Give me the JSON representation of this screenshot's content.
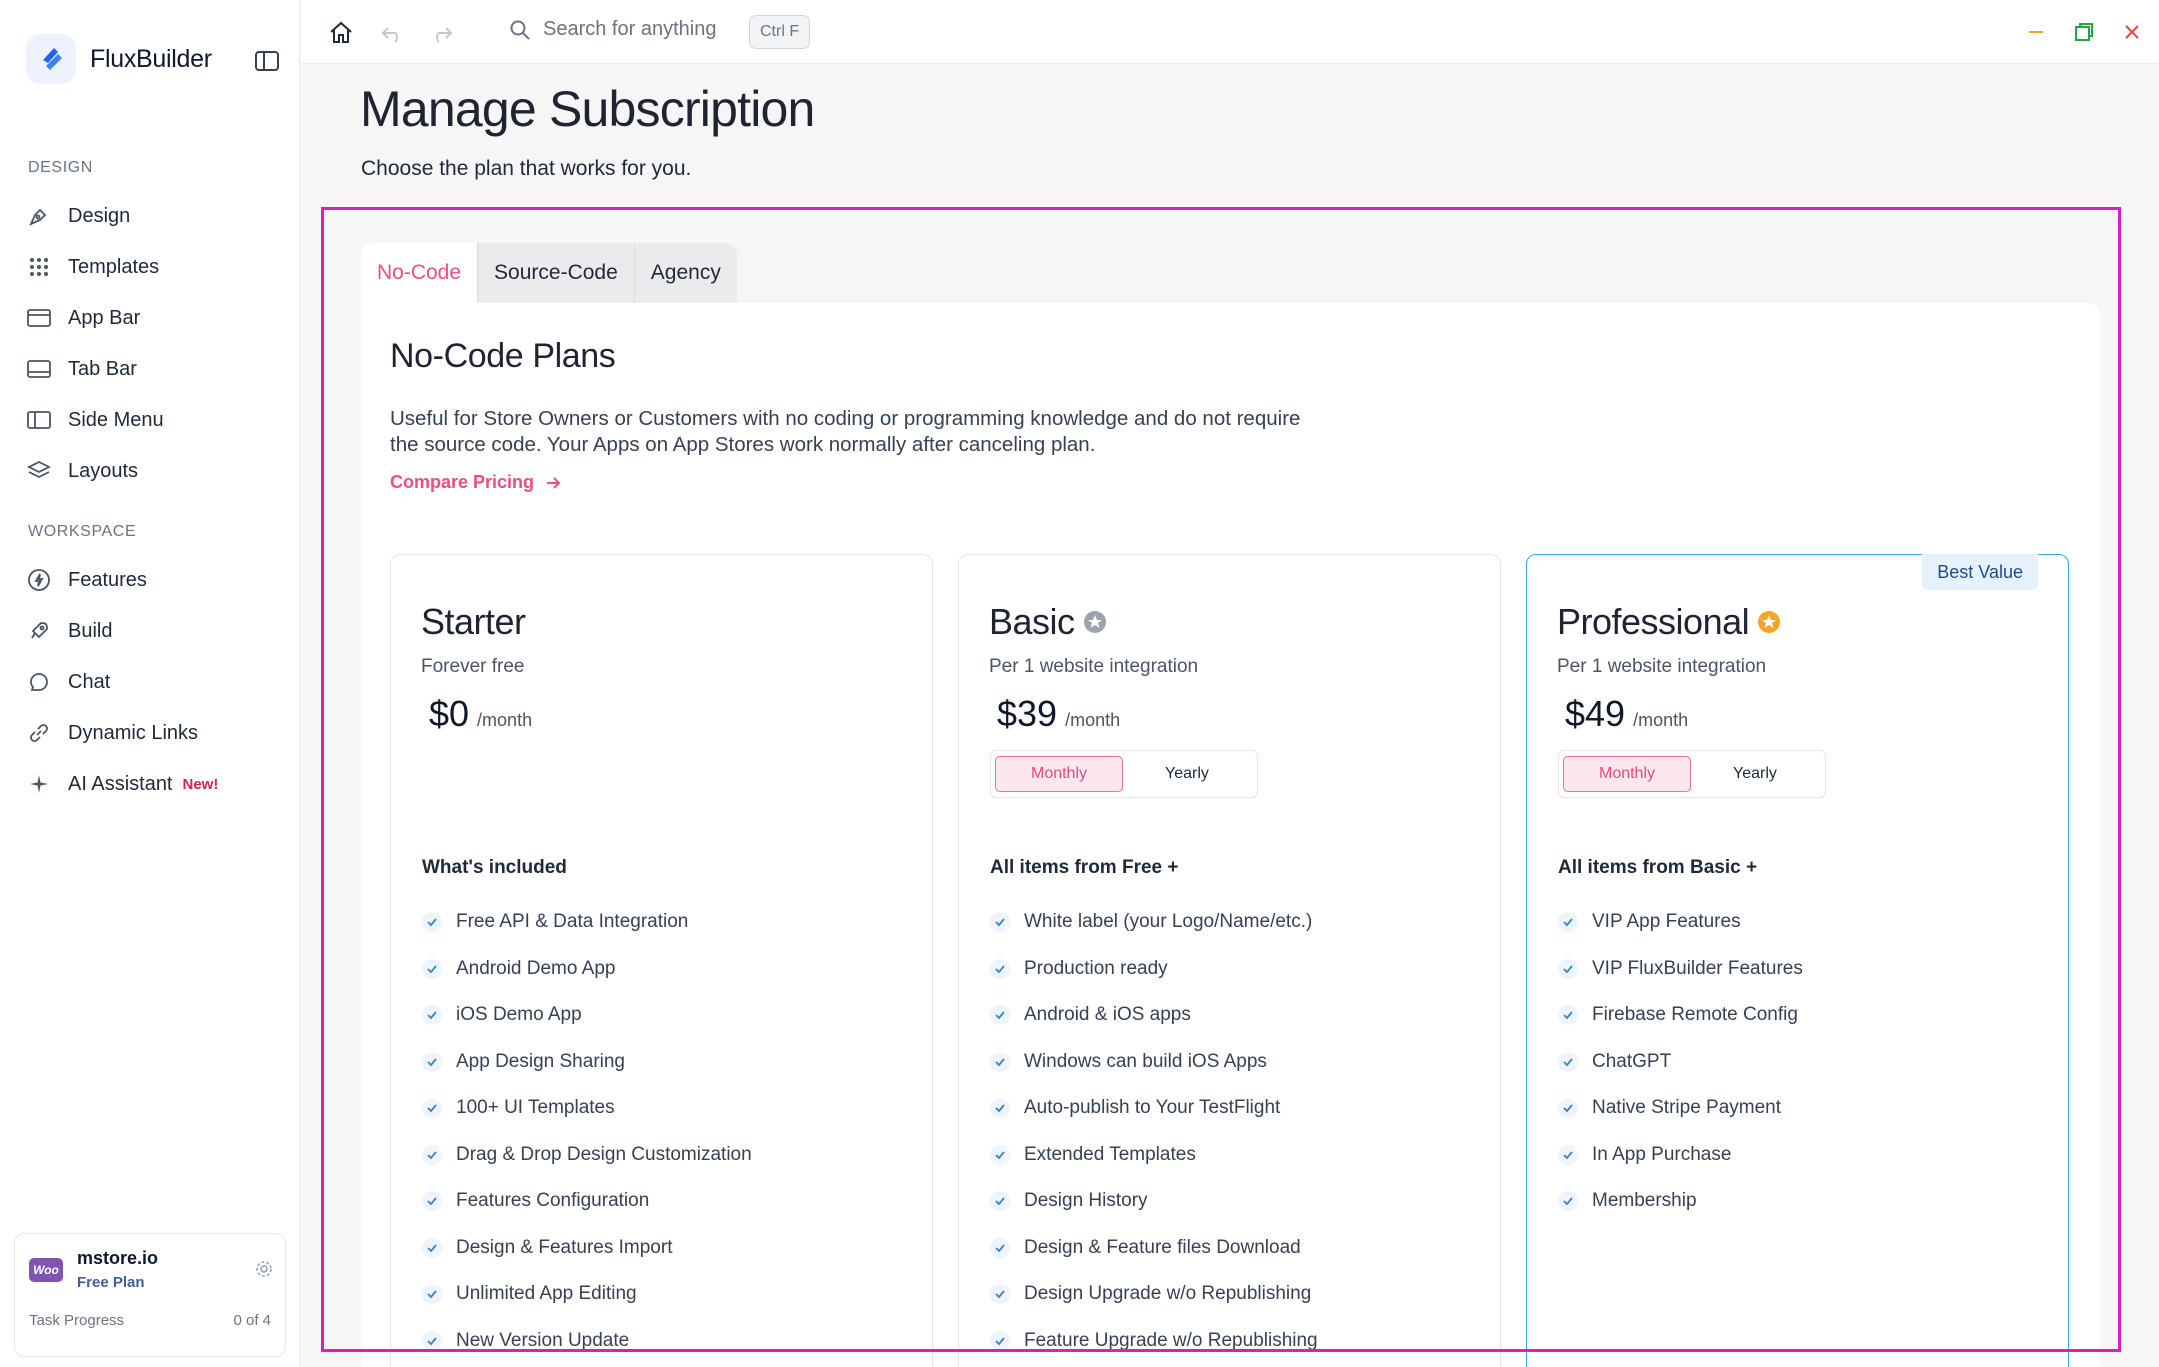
{
  "app": {
    "name": "FluxBuilder",
    "accent": "#ec4f7d",
    "brand_color": "#2563eb",
    "highlight_color": "#d91fc4"
  },
  "sidebar": {
    "sections": [
      {
        "title": "DESIGN",
        "items": [
          {
            "label": "Design",
            "icon": "pen-tool-icon"
          },
          {
            "label": "Templates",
            "icon": "grid-dots-icon"
          },
          {
            "label": "App Bar",
            "icon": "app-bar-icon"
          },
          {
            "label": "Tab Bar",
            "icon": "tab-bar-icon"
          },
          {
            "label": "Side Menu",
            "icon": "side-menu-icon"
          },
          {
            "label": "Layouts",
            "icon": "layers-icon"
          }
        ]
      },
      {
        "title": "WORKSPACE",
        "items": [
          {
            "label": "Features",
            "icon": "bolt-icon"
          },
          {
            "label": "Build",
            "icon": "rocket-icon"
          },
          {
            "label": "Chat",
            "icon": "chat-bubble-icon"
          },
          {
            "label": "Dynamic Links",
            "icon": "link-icon"
          },
          {
            "label": "AI Assistant",
            "icon": "sparkle-icon",
            "badge": "New!"
          }
        ]
      }
    ],
    "account": {
      "logo_text": "Woo",
      "name": "mstore.io",
      "plan": "Free Plan",
      "task_label": "Task Progress",
      "task_value": "0 of 4"
    }
  },
  "topbar": {
    "search_placeholder": "Search for anything",
    "shortcut": "Ctrl F"
  },
  "page": {
    "title": "Manage Subscription",
    "subtitle": "Choose the plan that works for you."
  },
  "tabs": [
    {
      "label": "No-Code",
      "active": true
    },
    {
      "label": "Source-Code",
      "active": false
    },
    {
      "label": "Agency",
      "active": false
    }
  ],
  "plans_section": {
    "title": "No-Code Plans",
    "description": "Useful for Store Owners or Customers with no coding or programming knowledge and do not require the source code. Your Apps on App Stores work normally after canceling plan.",
    "compare_label": "Compare Pricing"
  },
  "plans": [
    {
      "name": "Starter",
      "subtitle": "Forever free",
      "price": "$0",
      "unit": "/month",
      "included_title": "What's included",
      "features": [
        "Free API & Data Integration",
        "Android Demo App",
        "iOS Demo App",
        "App Design Sharing",
        "100+ UI Templates",
        "Drag & Drop Design Customization",
        "Features Configuration",
        "Design & Features Import",
        "Unlimited App Editing",
        "New Version Update"
      ]
    },
    {
      "name": "Basic",
      "star_color": "#9ca3af",
      "subtitle": "Per 1 website integration",
      "price": "$39",
      "unit": "/month",
      "billing": {
        "monthly": "Monthly",
        "yearly": "Yearly",
        "selected": "Monthly"
      },
      "included_title": "All items from Free +",
      "features": [
        "White label (your Logo/Name/etc.)",
        "Production ready",
        "Android & iOS apps",
        "Windows can build iOS Apps",
        "Auto-publish to Your TestFlight",
        "Extended Templates",
        "Design History",
        "Design & Feature files Download",
        "Design Upgrade w/o Republishing",
        "Feature Upgrade w/o Republishing"
      ]
    },
    {
      "name": "Professional",
      "star_color": "#f5a524",
      "badge": "Best Value",
      "subtitle": "Per 1 website integration",
      "price": "$49",
      "unit": "/month",
      "billing": {
        "monthly": "Monthly",
        "yearly": "Yearly",
        "selected": "Monthly"
      },
      "included_title": "All items from Basic +",
      "features": [
        "VIP App Features",
        "VIP FluxBuilder Features",
        "Firebase Remote Config",
        "ChatGPT",
        "Native Stripe Payment",
        "In App Purchase",
        "Membership"
      ]
    }
  ]
}
